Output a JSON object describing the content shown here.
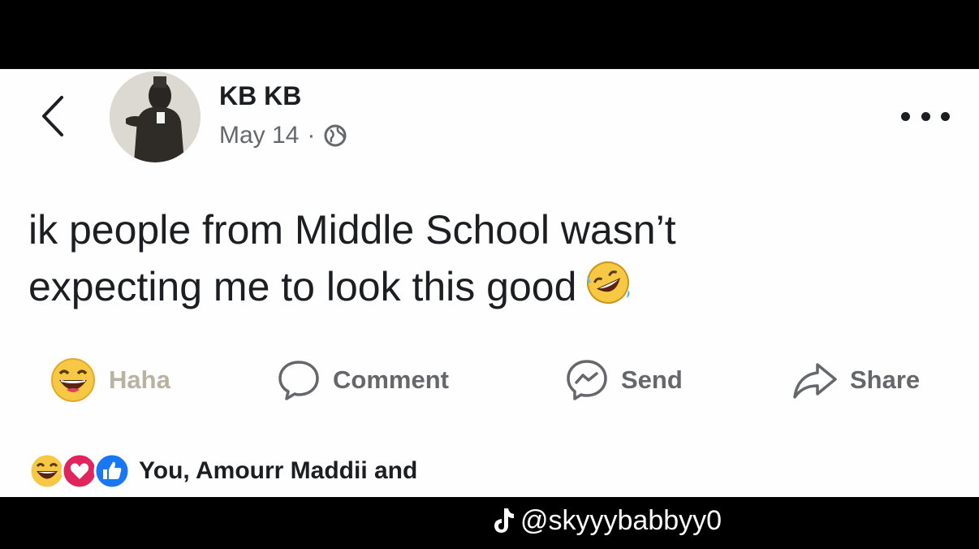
{
  "post": {
    "author": "KB KB",
    "date": "May 14",
    "separator": "·",
    "text_line1": "ik people from Middle School wasn’t",
    "text_line2": "expecting me to look this good"
  },
  "actions": {
    "haha": "Haha",
    "comment": "Comment",
    "send": "Send",
    "share": "Share"
  },
  "reactions": {
    "summary": "You, Amourr Maddii and "
  },
  "watermark": {
    "handle": "@skyyybabbyy0"
  },
  "colors": {
    "text": "#1c1e21",
    "secondary": "#65676b",
    "like_blue": "#1877f2",
    "love_pink": "#e0245e",
    "haha_yellow": "#f7c843"
  },
  "icons": [
    "back-chevron-icon",
    "globe-icon",
    "more-options-icon",
    "rofl-emoji-icon",
    "haha-reaction-icon",
    "comment-icon",
    "messenger-icon",
    "share-arrow-icon",
    "like-icon",
    "love-icon",
    "tiktok-icon"
  ]
}
